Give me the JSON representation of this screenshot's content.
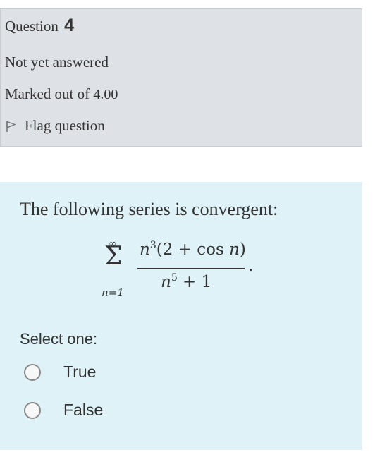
{
  "info": {
    "question_word": "Question",
    "question_number": "4",
    "state": "Not yet answered",
    "grade_prefix": "Marked out of",
    "grade_value": "4.00",
    "flag_label": "Flag question"
  },
  "question": {
    "text": "The following series is convergent:",
    "formula": {
      "upper_limit": "∞",
      "sigma": "Σ",
      "lower_limit": "n=1",
      "numerator_n": "n",
      "numerator_exp": "3",
      "numerator_rest": "(2 + cos ",
      "numerator_n2": "n",
      "numerator_close": ")",
      "denominator_n": "n",
      "denominator_exp": "5",
      "denominator_rest": " + 1",
      "period": "."
    }
  },
  "answer": {
    "prompt": "Select one:",
    "options": [
      {
        "label": "True",
        "selected": false
      },
      {
        "label": "False",
        "selected": false
      }
    ]
  },
  "colors": {
    "info_background": "#dee2e6",
    "content_background": "#def2f8",
    "text": "#333333"
  },
  "icons": {
    "flag": "flag-icon",
    "radio": "radio-button"
  }
}
